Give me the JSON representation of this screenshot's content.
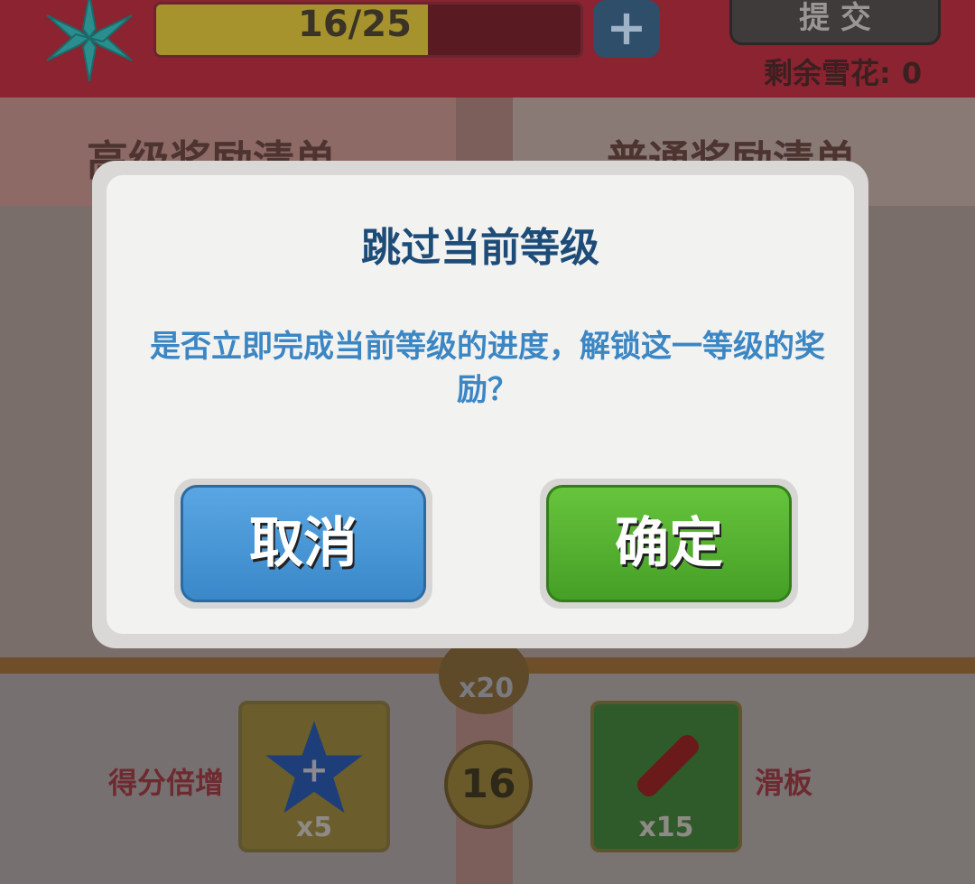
{
  "header": {
    "progress_text": "16/25",
    "progress_fraction": 0.64,
    "plus_icon": "+",
    "submit_label": "提 交",
    "remaining_label": "剩余雪花:",
    "remaining_value": "0"
  },
  "sections": {
    "premium_title": "高级奖励清单",
    "normal_title": "普通奖励清单"
  },
  "rewards": {
    "level": "16",
    "key_count": "x20",
    "left_item_label": "得分倍增",
    "left_item_count": "x5",
    "right_item_label": "滑板",
    "right_item_count": "x15"
  },
  "dialog": {
    "title": "跳过当前等级",
    "message": "是否立即完成当前等级的进度，解锁这一等级的奖励？",
    "cancel_label": "取消",
    "confirm_label": "确定"
  },
  "colors": {
    "cancel": "#3a88c9",
    "confirm": "#469f26",
    "title": "#1d4c78",
    "message": "#3b86c4"
  }
}
